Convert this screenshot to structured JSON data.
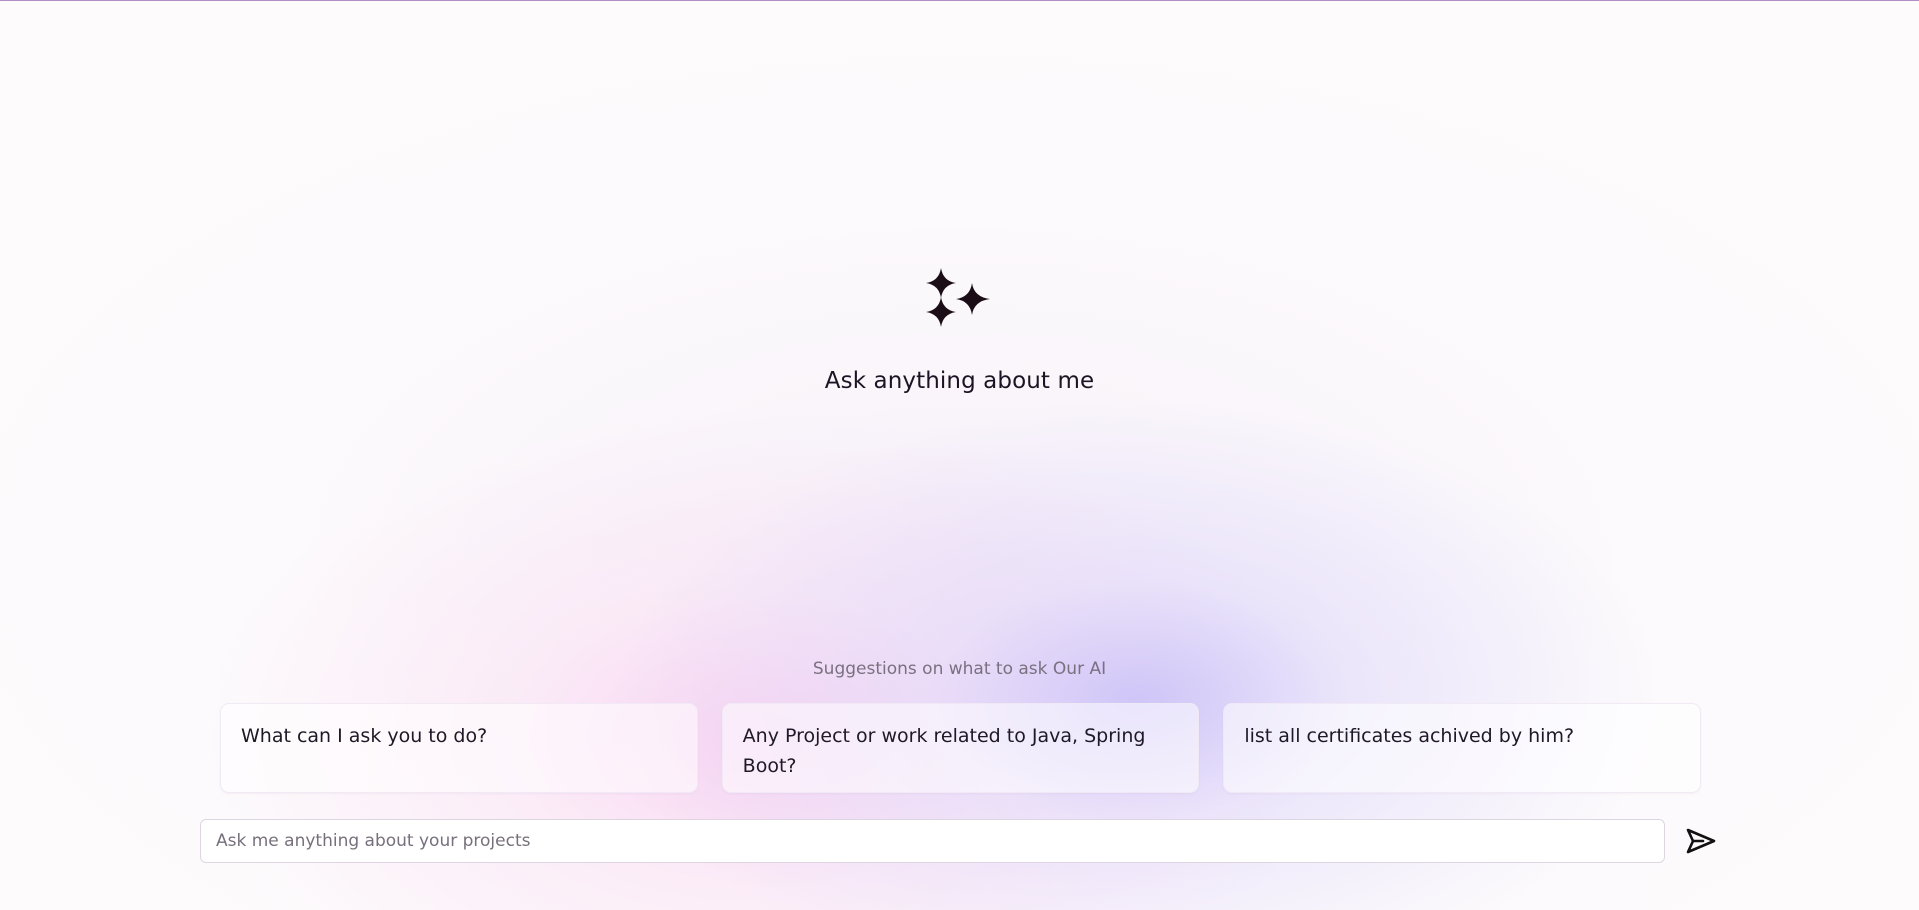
{
  "hero": {
    "icon": "sparkles-icon",
    "title": "Ask anything about me"
  },
  "suggestions": {
    "heading": "Suggestions on what to ask Our AI",
    "items": [
      {
        "label": "What can I ask you to do?"
      },
      {
        "label": "Any Project or work related to Java, Spring Boot?"
      },
      {
        "label": "list all certificates achived by him?"
      }
    ]
  },
  "chat": {
    "placeholder": "Ask me anything about your projects",
    "send_icon": "send-icon"
  },
  "colors": {
    "accent_line": "#b48cc6",
    "icon": "#1a0d16",
    "glow_pink": "#f8c8ee",
    "glow_violet": "#c8befa"
  }
}
